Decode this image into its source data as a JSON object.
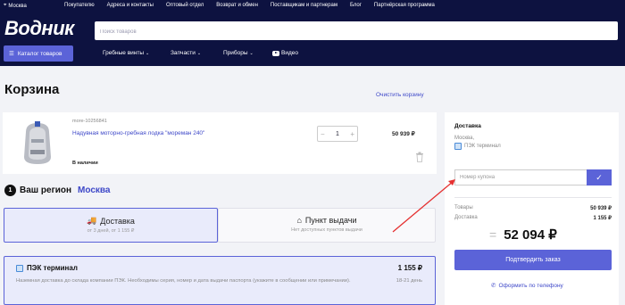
{
  "topbar": {
    "location": "Москва",
    "links": [
      "Покупателю",
      "Адреса и контакты",
      "Оптовый отдел",
      "Возврат и обмен",
      "Поставщикам и партнерам",
      "Блог",
      "Партнёрская программа"
    ]
  },
  "header": {
    "logo": "Водник",
    "search_placeholder": "Поиск товаров",
    "catalog_label": "Каталог товаров",
    "nav": {
      "propellers": "Гребные винты",
      "parts": "Запчасти",
      "devices": "Приборы",
      "video": "Видео"
    }
  },
  "page": {
    "title": "Корзина",
    "clear_cart": "Очистить корзину"
  },
  "product": {
    "sku": "more-10256841",
    "name": "Надувная моторно-гребная лодка \"мореман 240\"",
    "stock": "В наличии",
    "quantity": "1",
    "price": "50 939 ₽"
  },
  "region": {
    "number": "1",
    "label": "Ваш регион",
    "city": "Москва"
  },
  "delivery_tabs": [
    {
      "title": "Доставка",
      "subtitle": "от 3 дней, от 1 155 ₽"
    },
    {
      "title": "Пункт выдачи",
      "subtitle": "Нет доступных пунктов выдачи"
    }
  ],
  "pek": {
    "title": "ПЭК терминал",
    "description": "Наземная доставка до склада компании ПЭК. Необходимы серия, номер и дата выдачи паспорта (укажите в сообщении или примечании).",
    "price": "1 155 ₽",
    "days": "18-21 день"
  },
  "summary": {
    "heading": "Доставка",
    "city": "Москва,",
    "method": "ПЭК терминал",
    "coupon_placeholder": "Номер купона",
    "goods_label": "Товары",
    "goods_value": "50 939 ₽",
    "delivery_label": "Доставка",
    "delivery_value": "1 155 ₽",
    "total": "52 094 ₽",
    "confirm": "Подтвердить заказ",
    "phone_order": "Оформить по телефону"
  },
  "colors": {
    "navy": "#0d1240",
    "accent": "#5b63d8",
    "link": "#3d47c8",
    "annotation": "#e53030"
  }
}
